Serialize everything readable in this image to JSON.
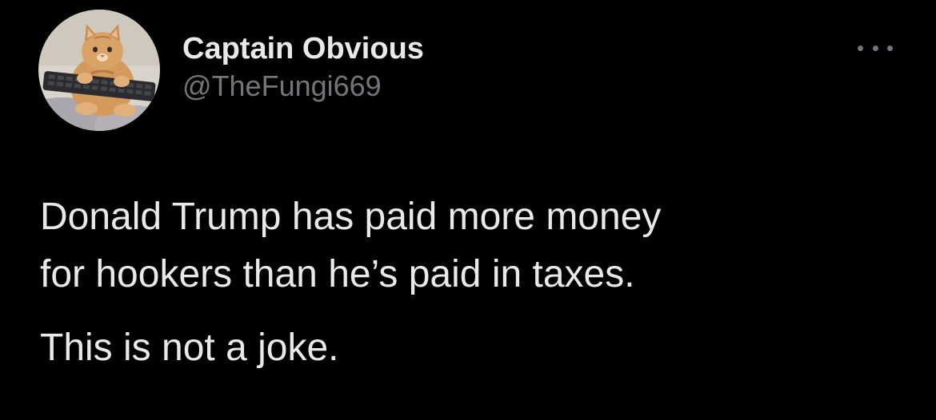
{
  "author": {
    "display_name": "Captain Obvious",
    "handle": "@TheFungi669",
    "avatar_icon": "cat-with-keyboard-avatar"
  },
  "menu": {
    "icon": "more-options-icon"
  },
  "tweet": {
    "lines": [
      "Donald Trump has paid more money",
      "for hookers than he’s paid in taxes.",
      "This is not a joke."
    ]
  },
  "colors": {
    "background": "#000000",
    "primary_text": "#e7e9ea",
    "secondary_text": "#71767b"
  }
}
